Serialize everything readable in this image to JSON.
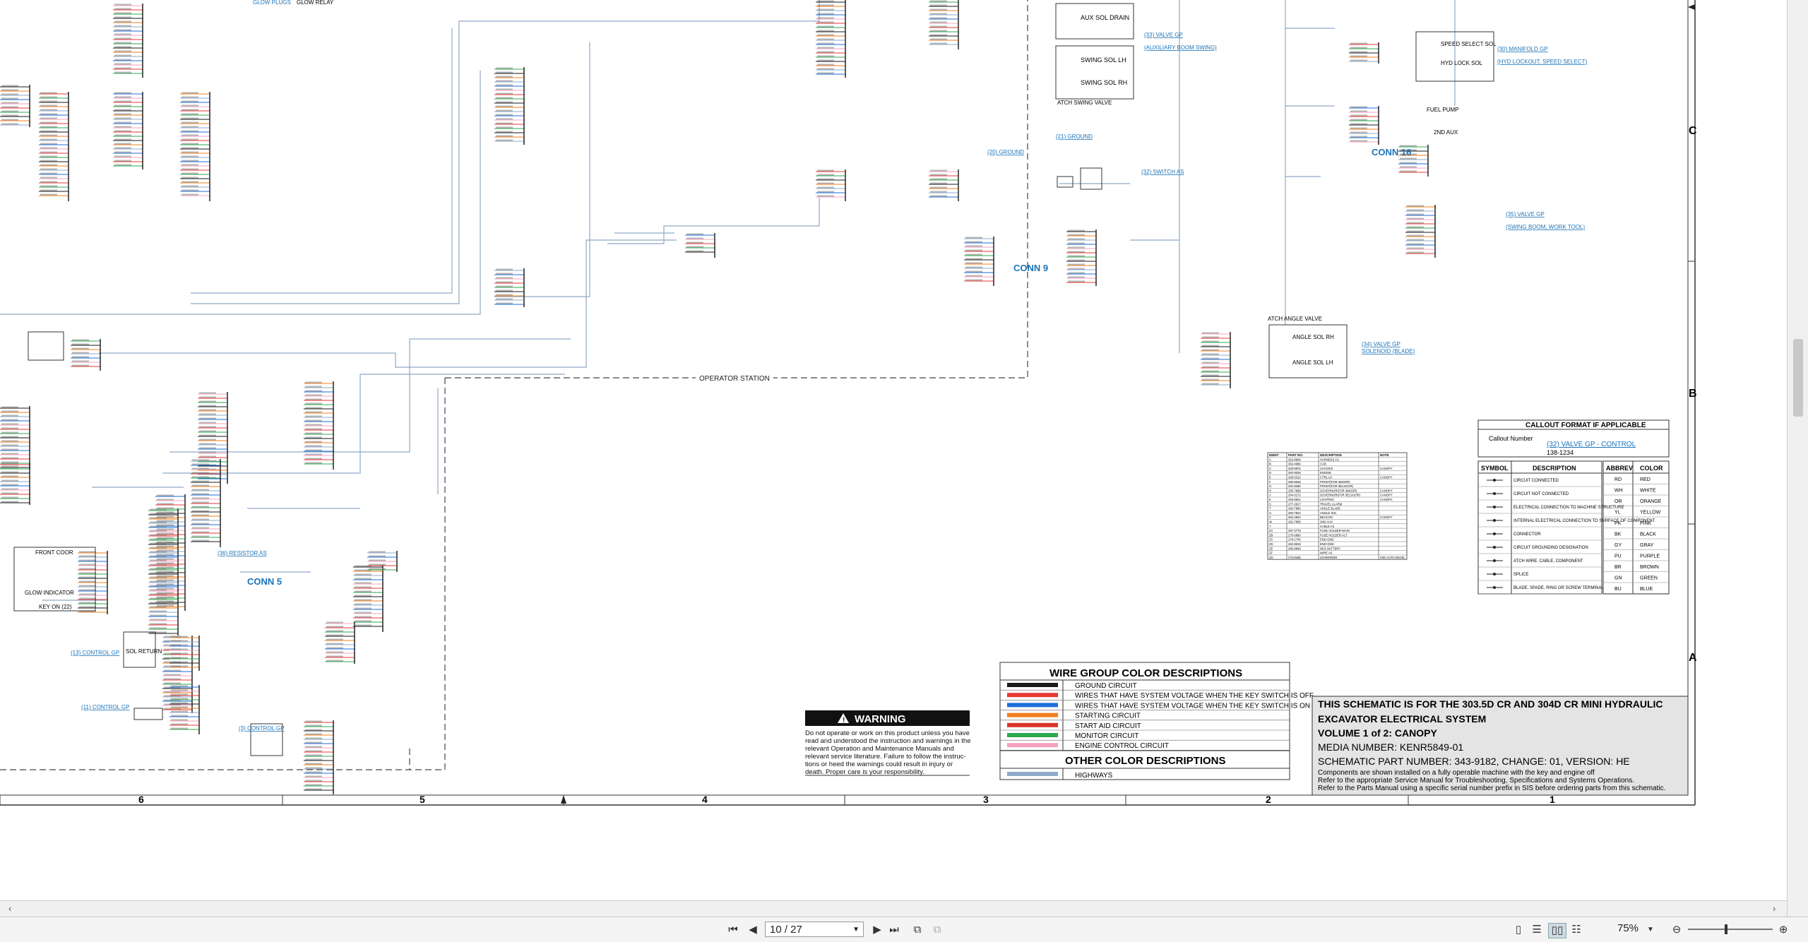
{
  "schematic": {
    "title_block": {
      "line1": "THIS SCHEMATIC IS FOR THE 303.5D CR AND 304D CR MINI HYDRAULIC",
      "line2": "EXCAVATOR ELECTRICAL SYSTEM",
      "line3": "VOLUME 1 of 2: CANOPY",
      "media": "MEDIA NUMBER: KENR5849-01",
      "part": "SCHEMATIC PART NUMBER: 343-9182, CHANGE: 01, VERSION: HE",
      "note1": "Components are shown installed on a fully operable machine with the key and engine off",
      "note2": "Refer to the appropriate Service Manual for Troubleshooting, Specifications and Systems Operations.",
      "note3": "Refer to the Parts Manual using a specific serial number prefix in SIS before ordering parts from this schematic."
    },
    "wire_group": {
      "title": "WIRE GROUP COLOR DESCRIPTIONS",
      "rows": [
        {
          "color": "#1a1a1a",
          "label": "GROUND CIRCUIT"
        },
        {
          "color": "#e53935",
          "label": "WIRES THAT HAVE SYSTEM VOLTAGE WHEN THE KEY SWITCH IS OFF"
        },
        {
          "color": "#1e6fd9",
          "label": "WIRES THAT HAVE SYSTEM VOLTAGE WHEN THE KEY SWITCH IS ON"
        },
        {
          "color": "#f07f1e",
          "label": "STARTING CIRCUIT"
        },
        {
          "color": "#d9332b",
          "label": "START AID CIRCUIT"
        },
        {
          "color": "#2fa84f",
          "label": "MONITOR CIRCUIT"
        },
        {
          "color": "#f5a3c0",
          "label": "ENGINE CONTROL CIRCUIT"
        }
      ],
      "other_title": "OTHER COLOR DESCRIPTIONS",
      "other_rows": [
        {
          "color": "#8fa9c8",
          "label": "HIGHWAYS"
        }
      ]
    },
    "warning": {
      "title": "WARNING",
      "lines": [
        "Do not operate or work on this product unless you have",
        "read and understood the instruction and warnings in the",
        "relevant Operation and Maintenance Manuals and",
        "relevant service literature. Failure to follow the instruc-",
        "tions or heed the warnings could result in injury or",
        "death. Proper care is your responsibility."
      ]
    },
    "callout": {
      "title": "CALLOUT FORMAT IF APPLICABLE",
      "callout_number": "Callout Number",
      "example": "(32) VALVE GP - CONTROL",
      "part": "138-1234"
    },
    "symbols": {
      "headers": [
        "SYMBOL",
        "DESCRIPTION"
      ],
      "rows": [
        "CIRCUIT CONNECTED",
        "CIRCUIT NOT CONNECTED",
        "ELECTRICAL CONNECTION TO MACHINE STRUCTURE",
        "INTERNAL ELECTRICAL CONNECTION TO SURFACE OF COMPONENT",
        "CONNECTOR",
        "CIRCUIT GROUNDING DESIGNATION",
        "ATCH WIRE, CABLE, COMPONENT",
        "SPLICE",
        "BLADE, SPADE, RING OR SCREW TERMINAL"
      ]
    },
    "abbrev": {
      "headers": [
        "ABBREV",
        "COLOR"
      ],
      "rows": [
        [
          "RD",
          "RED"
        ],
        [
          "WH",
          "WHITE"
        ],
        [
          "OR",
          "ORANGE"
        ],
        [
          "YL",
          "YELLOW"
        ],
        [
          "PK",
          "PINK"
        ],
        [
          "BK",
          "BLACK"
        ],
        [
          "GY",
          "GRAY"
        ],
        [
          "PU",
          "PURPLE"
        ],
        [
          "BR",
          "BROWN"
        ],
        [
          "GN",
          "GREEN"
        ],
        [
          "BU",
          "BLUE"
        ]
      ]
    },
    "ident": {
      "headers": [
        "IDENT",
        "PART NO.",
        "DESCRIPTION",
        "NOTE"
      ],
      "rows": [
        [
          "A",
          "252-8846",
          "HARNESS AS",
          ""
        ],
        [
          "B",
          "362-4966",
          "CAB",
          ""
        ],
        [
          "C",
          "329-9876",
          "CHASSIS",
          "CANOPY"
        ],
        [
          "D",
          "262-9026",
          "ENGINE",
          ""
        ],
        [
          "E",
          "293-5312",
          "CTRL LH",
          "CANOPY"
        ],
        [
          "F",
          "280-8548",
          "FRONT(FOR 3MOOR)",
          ""
        ],
        [
          "G",
          "262-8496",
          "FRONT(FOR 3ELSOOR)",
          ""
        ],
        [
          "H",
          "255-7888",
          "GOVERNOR(FOR 3MOOR)",
          "CANOPY"
        ],
        [
          "J",
          "284-3172",
          "GOVERNOR(FOR 3ELSOOR)",
          "CANOPY"
        ],
        [
          "K",
          "253-8841",
          "LIGHTING",
          "CANOPY"
        ],
        [
          "S",
          "277-2917",
          "TRAVEL ALARM",
          ""
        ],
        [
          "T",
          "283-7880",
          "ANGLE BLADE",
          ""
        ],
        [
          "U",
          "283-7844",
          "ANGLE SOL",
          ""
        ],
        [
          "V",
          "262-2804",
          "BEACON",
          "CANOPY"
        ],
        [
          "W",
          "262-7889",
          "2ND AUX",
          ""
        ],
        [
          "Y",
          "",
          "CABLE AS",
          ""
        ],
        [
          "ZA",
          "267-4778",
          "FUSE HOLDER-MAIN",
          ""
        ],
        [
          "ZB",
          "270-0880",
          "FUSE HOLDER-ALT",
          ""
        ],
        [
          "ZC",
          "278-1745",
          "END-GND",
          ""
        ],
        [
          "ZD",
          "262-8815",
          "END-GND",
          ""
        ],
        [
          "ZE",
          "280-8846",
          "NEG BATTERY",
          ""
        ],
        [
          "ZF",
          "",
          "WIRE AS",
          ""
        ],
        [
          "ZG",
          "273-8436",
          "GOVERNOR",
          "IVID AUTO DECEL"
        ]
      ]
    },
    "labels": {
      "operator_station": "OPERATOR STATION",
      "conn9": "CONN 9",
      "conn16": "CONN 16",
      "conn5": "CONN 5",
      "aux_drain": "AUX SOL DRAIN",
      "swing_lh": "SWING SOL LH",
      "swing_rh": "SWING SOL RH",
      "atch_swing": "ATCH SWING VALVE",
      "speed_select": "SPEED SELECT SOL",
      "hyd_lock": "HYD LOCK SOL",
      "fuel_pump": "FUEL PUMP",
      "second_aux": "2ND AUX",
      "angle_rh": "ANGLE SOL RH",
      "angle_lh": "ANGLE SOL LH",
      "atch_angle": "ATCH ANGLE VALVE",
      "front_door": "FRONT COOR",
      "key_on": "KEY ON (22)",
      "glow_indicator": "GLOW INDICATOR",
      "sol_return": "SOL RETURN",
      "glow_plugs": "GLOW PLUGS",
      "glow_relay": "GLOW RELAY",
      "link_valve_gp": "(33) VALVE GP",
      "link_aux_swing": "(AUXILIARY BOOM SWING)",
      "link_ground": "(20) GROUND",
      "link_platform": "(21) GROUND",
      "link_switch": "(32) SWITCH AS",
      "link_manifold": "(30) MANIFOLD GP",
      "link_manifold_sub": "(HYD LOCKOUT, SPEED SELECT)",
      "link_valve_blade": "(34) VALVE GP",
      "link_valve_blade_sub": "SOLENOID (BLADE)",
      "link_valve_work": "(35) VALVE GP",
      "link_valve_work_sub": "(SWING BOOM, WORK TOOL)",
      "link_resistor": "(36) RESISTOR AS",
      "link_control_gp": "(13) CONTROL GP",
      "link_control_gp2": "(11) CONTROL GP",
      "link_control_gp3": "(3) CONTROL GP"
    },
    "zones_right": [
      "C",
      "B",
      "A"
    ],
    "columns": [
      "6",
      "5",
      "4",
      "3",
      "2",
      "1"
    ]
  },
  "toolbar": {
    "page_value": "10 / 27",
    "zoom": "75%"
  }
}
